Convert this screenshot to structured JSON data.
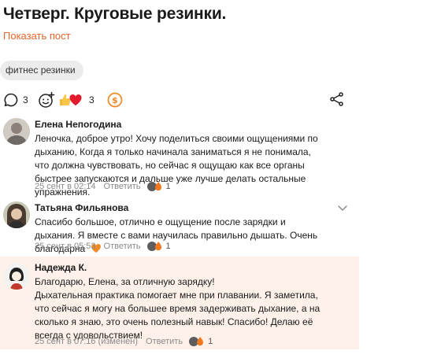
{
  "post": {
    "title": "Четверг. Круговые резинки.",
    "show_post_label": "Показать пост",
    "tag": "фитнес резинки",
    "comments_count": "3",
    "reactions_count": "3"
  },
  "comments": [
    {
      "author": "Елена Непогодина",
      "text": "Леночка, доброе утро! Хочу поделиться своими ощущениями по дыханию, Когда я только начинала заниматься я не понимала, что должна чувствовать, но сейчас я ощущаю как все органы быстрее запускаются и дальше уже лучше делать остальные упражнения.",
      "time": "25 сент в 02:14",
      "reply_label": "Ответить",
      "reaction_count": "1"
    },
    {
      "author": "Татьяна Фильянова",
      "text": "Спасибо большое, отлично е ощущение после зарядки и дыхания. Я вместе с вами научилась правильно дышать. Очень благодарна",
      "time": "25 сент в 05:53",
      "reply_label": "Ответить",
      "reaction_count": "1"
    },
    {
      "author": "Надежда К.",
      "text": "Благодарю, Елена, за отличную зарядку!\nДыхательная практика помогает мне при плавании. Я заметила, что сейчас я могу на большее время задерживать дыхание, а на сколько я знаю, это очень полезный навык! Спасибо! Делаю её всегда с удовольствием!",
      "time": "25 сент в 07:16 (изменен)",
      "reply_label": "Ответить",
      "reaction_count": "1"
    }
  ],
  "colors": {
    "accent": "#e8652a",
    "highlight": "#fdf1e9",
    "tag_bg": "#ececec"
  }
}
